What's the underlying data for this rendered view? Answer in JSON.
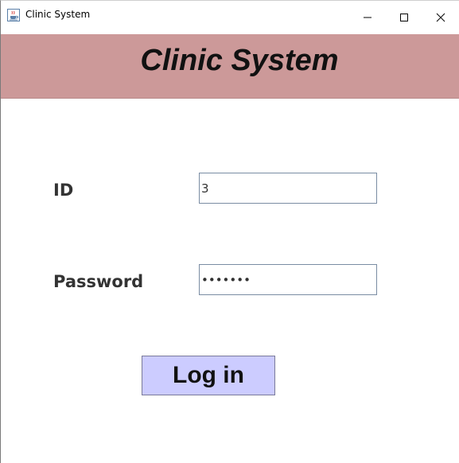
{
  "window": {
    "title": "Clinic System",
    "controls": {
      "minimize_icon": "minimize-icon",
      "maximize_icon": "maximize-icon",
      "close_icon": "close-icon"
    },
    "app_icon": "java-coffee-cup-icon"
  },
  "header": {
    "title": "Clinic System",
    "background": "#cc9999"
  },
  "form": {
    "id_label": "ID",
    "id_value": "3",
    "password_label": "Password",
    "password_value": "•••••••",
    "login_label": "Log in",
    "login_button_color": "#ccccff"
  }
}
